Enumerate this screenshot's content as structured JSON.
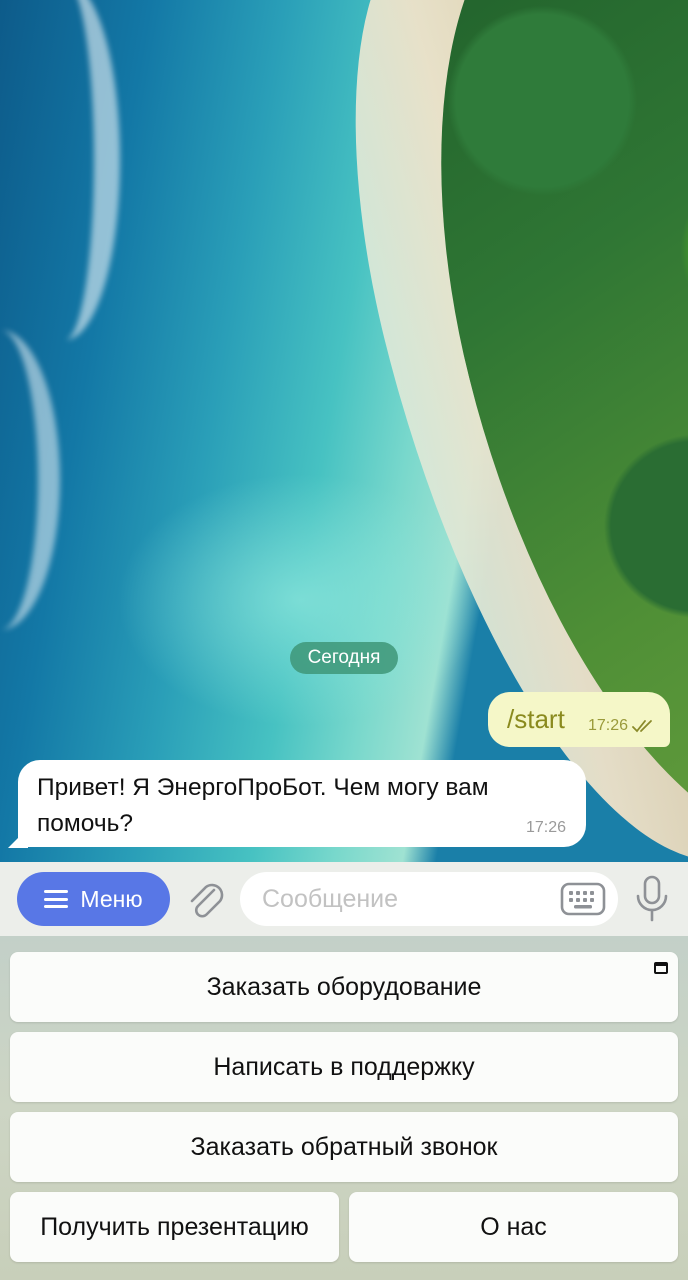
{
  "chat": {
    "date_label": "Сегодня",
    "outgoing": {
      "text": "/start",
      "time": "17:26",
      "status": "read"
    },
    "incoming": {
      "text": "Привет! Я ЭнергоПроБот. Чем могу вам помочь?",
      "time": "17:26"
    }
  },
  "input_bar": {
    "menu_label": "Меню",
    "message_placeholder": "Сообщение",
    "icons": [
      "menu-icon",
      "paperclip-icon",
      "keyboard-icon",
      "microphone-icon"
    ]
  },
  "keyboard": {
    "buttons": [
      "Заказать оборудование",
      "Написать в поддержку",
      "Заказать обратный звонок",
      "Получить презентацию",
      "О нас"
    ]
  },
  "colors": {
    "menu_button": "#5877e6",
    "outgoing_bubble": "#f5f7c8",
    "incoming_bubble": "#ffffff",
    "date_pill": "#3e9678"
  }
}
